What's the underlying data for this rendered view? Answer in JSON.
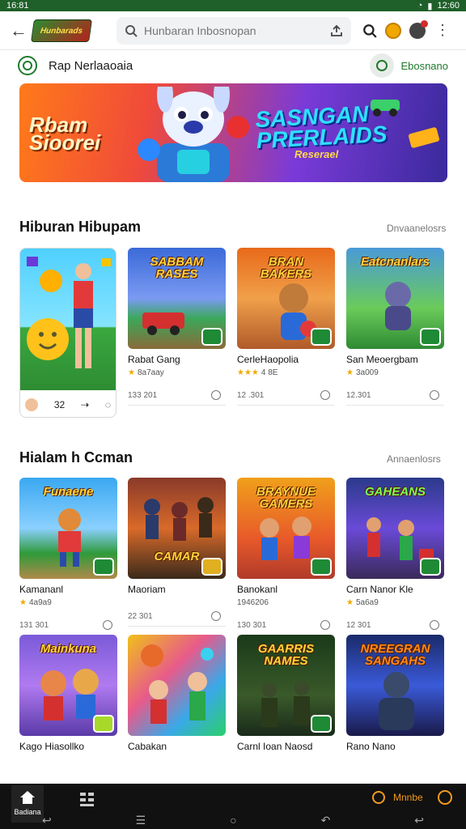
{
  "status": {
    "time_left": "16:81",
    "time_right": "12:60"
  },
  "topbar": {
    "logo_text": "Hunbarads",
    "search_placeholder": "Hunbaran Inbosnopan"
  },
  "tabrow": {
    "label": "Rap Nerlaaoaia",
    "pill_label": "Ebosnano"
  },
  "banner": {
    "left_text": "Rbam\nSioorei",
    "right_text": "SASNGAN PRERLAIDS",
    "sub_text": "Reserael"
  },
  "section1": {
    "title": "Hiburan Hibupam",
    "more": "Dnvaanelosrs",
    "big_card_value": "32",
    "cards": [
      {
        "thumb_title": "SABBAM RASES",
        "name": "Rabat Gang",
        "rating": "8a7aay",
        "meta": "133 201"
      },
      {
        "thumb_title": "BRAN BAKERS",
        "name": "CerleHaopolia",
        "rating": "4 8E",
        "meta": "12 .301"
      },
      {
        "thumb_title": "Eatcnanlars",
        "name": "San Meoergbam",
        "rating": "3a009",
        "meta": "12.301"
      }
    ]
  },
  "section2": {
    "title": "Hialam h Ccman",
    "more": "Annaenlosrs",
    "row1": [
      {
        "thumb_title": "Funaene",
        "name": "Kamananl",
        "rating": "4a9a9",
        "meta": "131 301"
      },
      {
        "thumb_title": "CAMAR",
        "name": "Maoriam",
        "rating": "",
        "meta": "22 301"
      },
      {
        "thumb_title": "BRAYNUE GAMERS",
        "name": "Banokanl",
        "rating": "1946206",
        "meta": "130 301"
      },
      {
        "thumb_title": "GAHEANS",
        "name": "Carn Nanor Kle",
        "rating": "5a6a9",
        "meta": "12 301"
      }
    ],
    "row2": [
      {
        "thumb_title": "Mainkuna",
        "name": "Kago Hiasollko",
        "meta": ""
      },
      {
        "thumb_title": "",
        "name": "Cabakan",
        "meta": ""
      },
      {
        "thumb_title": "GAARRIS NAMES",
        "name": "Carnl Ioan Naosd",
        "meta": ""
      },
      {
        "thumb_title": "NREEGRAN SANGAHS",
        "name": "Rano Nano",
        "meta": ""
      }
    ]
  },
  "bottomnav": {
    "home_label": "Badiana",
    "right_label": "Mnnbe"
  }
}
